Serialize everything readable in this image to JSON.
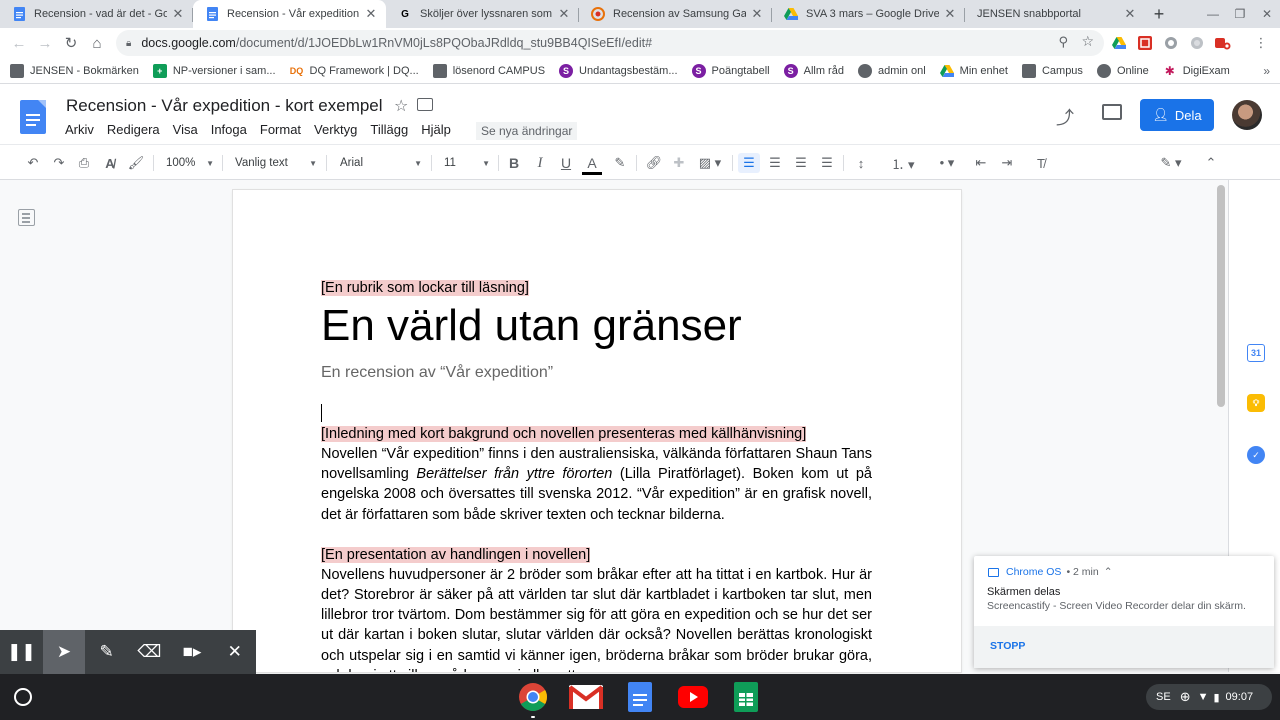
{
  "tabs": [
    {
      "title": "Recension - vad är det - Google",
      "favicon": "docs",
      "active": false
    },
    {
      "title": "Recension - Vår expedition - k",
      "favicon": "docs",
      "active": true
    },
    {
      "title": "Sköljer över lyssnaren som se",
      "favicon": "google",
      "active": false
    },
    {
      "title": "Recension av Samsung Galax",
      "favicon": "chrome-ext",
      "active": false
    },
    {
      "title": "SVA 3 mars – Google Drive",
      "favicon": "drive",
      "active": false
    },
    {
      "title": "JENSEN snabbportal",
      "favicon": "none",
      "active": false
    }
  ],
  "omnibox": {
    "host": "docs.google.com",
    "path": "/document/d/1JOEDbLw1RnVM0jLs8PQObaJRdldq_stu9BB4QISeEfI/edit#"
  },
  "bookmarks": [
    {
      "label": "JENSEN - Bokmärken",
      "icon": "folder",
      "color": "#5f6368"
    },
    {
      "label": "NP-versioner i sam...",
      "icon": "sheets-plus",
      "color": "#0f9d58"
    },
    {
      "label": "DQ Framework | DQ...",
      "icon": "dq-logo",
      "color": "#e8710a"
    },
    {
      "label": "lösenord CAMPUS",
      "icon": "campus",
      "color": "#5f6368"
    },
    {
      "label": "Undantagsbestäm...",
      "icon": "s-logo",
      "color": "#7b1fa2"
    },
    {
      "label": "Poängtabell",
      "icon": "s-logo",
      "color": "#7b1fa2"
    },
    {
      "label": "Allm råd",
      "icon": "s-logo",
      "color": "#7b1fa2"
    },
    {
      "label": "admin onl",
      "icon": "globe",
      "color": "#5f6368"
    },
    {
      "label": "Min enhet",
      "icon": "drive",
      "color": "#fbbc04"
    },
    {
      "label": "Campus",
      "icon": "campus",
      "color": "#5f6368"
    },
    {
      "label": "Online",
      "icon": "globe",
      "color": "#5f6368"
    },
    {
      "label": "DigiExam",
      "icon": "digiexam",
      "color": "#c2185b"
    }
  ],
  "doc": {
    "title": "Recension - Vår expedition - kort exempel",
    "menu": [
      "Arkiv",
      "Redigera",
      "Visa",
      "Infoga",
      "Format",
      "Verktyg",
      "Tillägg",
      "Hjälp"
    ],
    "see_changes": "Se nya ändringar",
    "share_label": "Dela"
  },
  "toolbar": {
    "zoom": "100%",
    "style": "Vanlig text",
    "font": "Arial",
    "size": "11"
  },
  "content": {
    "bracket1": "[En rubrik som lockar till läsning]",
    "title": "En värld utan gränser",
    "subtitle": "En recension av “Vår expedition”",
    "bracket2": "[Inledning med kort bakgrund och novellen presenteras med källhänvisning]",
    "para1_a": "Novellen “Vår expedition” finns i den australiensiska, välkända författaren Shaun Tans novellsamling ",
    "para1_italic": "Berättelser från yttre förorten",
    "para1_b": " (Lilla Piratförlaget). Boken kom ut på engelska 2008 och översattes till svenska 2012. “Vår expedition” är en grafisk novell, det är författaren som både skriver texten och tecknar bilderna.",
    "bracket3": "[En presentation av handlingen i novellen]",
    "para2": "Novellens huvudpersoner är 2 bröder som bråkar efter att ha tittat i en kartbok. Hur är det? Storebror är säker på att världen tar slut där kartbladet i kartboken tar slut, men lillebror tror tvärtom. Dom bestämmer sig för att göra en expedition och se hur det ser ut där kartan i boken slutar, slutar världen där också? Novellen berättas kronologiskt och utspelar sig i en samtid vi känner igen, bröderna bråkar som bröder brukar göra, och bor i ett villaområde som vi alla gott"
  },
  "notification": {
    "source": "Chrome OS",
    "time": "• 2 min",
    "title": "Skärmen delas",
    "message": "Screencastify - Screen Video Recorder delar din skärm.",
    "action": "STOPP"
  },
  "shelf": {
    "language": "SE",
    "time": "09:07"
  },
  "colors": {
    "accent": "#1a73e8",
    "highlight": "#f4cccc",
    "tabstrip": "#dee1e6"
  }
}
